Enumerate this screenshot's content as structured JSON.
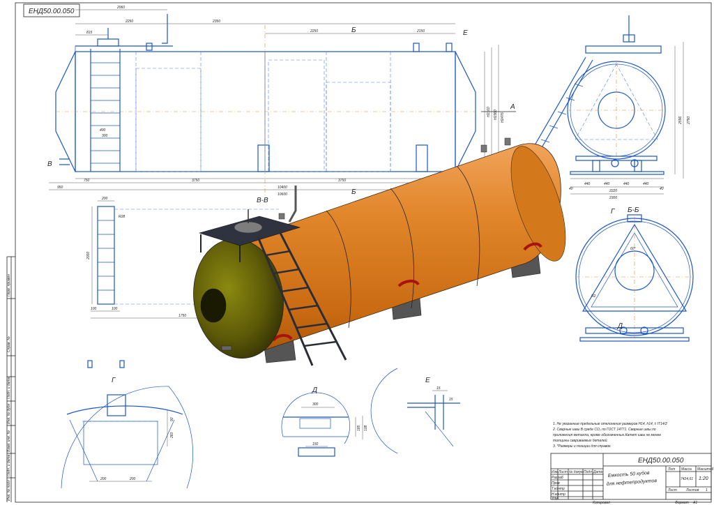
{
  "drawing": {
    "code_rotated": "ЕНД50.00.050",
    "code_title": "ЕНД50.00.050",
    "title_line1": "Емкость 50 кубов",
    "title_line2": "для нефтепродуктов",
    "scale_header": "Масштаб",
    "mass_header": "Масса",
    "letter_header": "Лит",
    "mass_value": "7424,61",
    "scale_value": "1:20",
    "sheet_label": "Лист",
    "sheets_label": "Листов",
    "sheets_value": "1",
    "copied_label": "Копировал",
    "format_label": "Формат",
    "format_value": "А1"
  },
  "title_block_labels": {
    "izm": "Изм",
    "list": "Лист",
    "ndokum": "№ докум",
    "podp": "Подп",
    "data": "Дата",
    "razrab": "Разраб",
    "prov": "Пров",
    "tkontr": "Т.контр",
    "nkontr": "Н.контр",
    "utv": "Утв"
  },
  "margin_labels": {
    "perv_primen": "Перв. примен",
    "sprav": "Справ. №",
    "podp_data1": "Подп. и дата",
    "inv_dubl": "Инв. № дубл",
    "vzam_inv": "Взам. инв. №",
    "podp_data2": "Подп. и дата",
    "inv_podl": "Инв. № подл"
  },
  "notes": [
    "1. Не указанные предельные отклонения размеров Н14, h14, ± IT14/2",
    "2. Сварные швы В среде СО₂ по ГОСТ 14771. Сварные швы по",
    "приложения металла, кроме обозначенных.Катет швы не менее",
    "толщины свариваемых деталей.",
    "3. *Размеры и позиции для справок."
  ],
  "view_labels": {
    "b_top": "Б",
    "b_bottom": "Б",
    "e_mark": "Е",
    "a_mark": "А",
    "v_mark": "В",
    "vv": "В-В",
    "g_mark": "Г",
    "bb": "Б-Б",
    "d_mark": "Д",
    "g_detail": "Г",
    "d_detail": "Д",
    "e_detail": "Е"
  },
  "dimensions": {
    "top_2060": "2060",
    "top_2250a": "2250",
    "top_2350": "2350",
    "top_2250b": "2250",
    "top_2150": "2150",
    "top_815": "815",
    "left_750": "750",
    "mid_3750": "3750",
    "mid_3750b": "3750",
    "bot_950": "950",
    "bot_10400": "10400",
    "bot_10600": "10600",
    "lad_400": "400",
    "lad_300": "300",
    "vv_200": "200",
    "vv_2000": "2000",
    "vv_100a": "100",
    "vv_100b": "100",
    "vv_1750": "1750",
    "vv_r28": "R28",
    "side_440a": "440",
    "side_440b": "440",
    "side_440c": "440",
    "side_440d": "440",
    "side_2220": "2220",
    "side_2300": "2300",
    "side_40a": "40",
    "side_40b": "40",
    "side_2596": "2596",
    "side_2790": "2790",
    "h_2160": "Н2160",
    "h_2360": "Н2360",
    "h_2476": "Н2476",
    "bb_60": "60°",
    "bb_r2": "R2",
    "gd_200a": "200",
    "gd_200b": "200",
    "gd_90": "90",
    "gd_260": "260",
    "dd_300": "300",
    "dd_185": "185",
    "dd_150": "150",
    "dd_108": "108",
    "ed_15": "15",
    "ed_15b": "15"
  }
}
